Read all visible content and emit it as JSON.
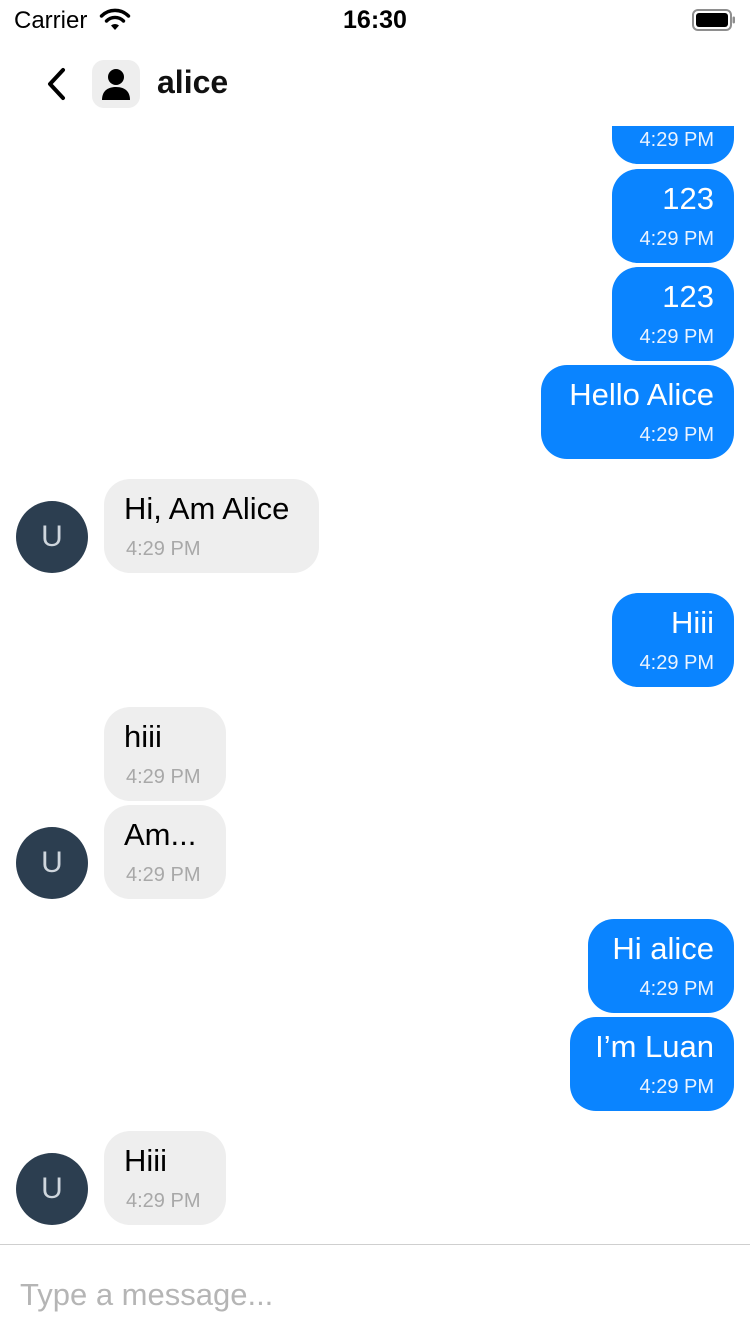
{
  "status_bar": {
    "carrier": "Carrier",
    "time": "16:30"
  },
  "header": {
    "title": "alice",
    "back_icon": "chevron-left-icon",
    "avatar_icon": "person-icon"
  },
  "colors": {
    "outgoing_bubble": "#0a84ff",
    "incoming_bubble": "#eeeeee",
    "avatar_bg": "#2c3e50"
  },
  "messages": [
    {
      "direction": "out",
      "text": "",
      "time": "4:29 PM"
    },
    {
      "direction": "out",
      "text": "123",
      "time": "4:29 PM"
    },
    {
      "direction": "out",
      "text": "123",
      "time": "4:29 PM"
    },
    {
      "direction": "out",
      "text": "Hello Alice",
      "time": "4:29 PM"
    },
    {
      "direction": "in",
      "text": "Hi, Am Alice",
      "time": "4:29 PM",
      "avatar": "U"
    },
    {
      "direction": "out",
      "text": "Hiii",
      "time": "4:29 PM"
    },
    {
      "direction": "in",
      "text": "hiii",
      "time": "4:29 PM"
    },
    {
      "direction": "in",
      "text": "Am...",
      "time": "4:29 PM",
      "avatar": "U"
    },
    {
      "direction": "out",
      "text": "Hi alice",
      "time": "4:29 PM"
    },
    {
      "direction": "out",
      "text": "I’m Luan",
      "time": "4:29 PM"
    },
    {
      "direction": "in",
      "text": "Hiii",
      "time": "4:29 PM",
      "avatar": "U"
    }
  ],
  "composer": {
    "placeholder": "Type a message..."
  }
}
